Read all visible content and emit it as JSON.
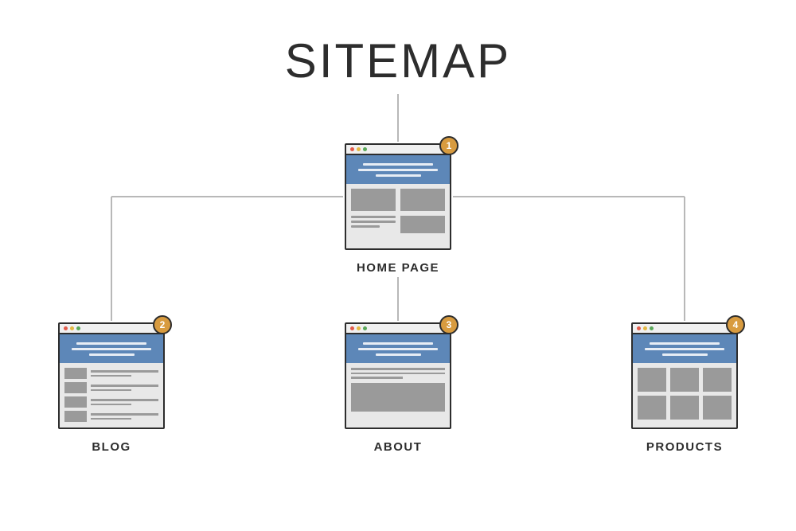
{
  "title": "SITEMAP",
  "nodes": {
    "home": {
      "badge": "1",
      "label": "HOME PAGE"
    },
    "blog": {
      "badge": "2",
      "label": "BLOG"
    },
    "about": {
      "badge": "3",
      "label": "ABOUT"
    },
    "products": {
      "badge": "4",
      "label": "PRODUCTS"
    }
  }
}
